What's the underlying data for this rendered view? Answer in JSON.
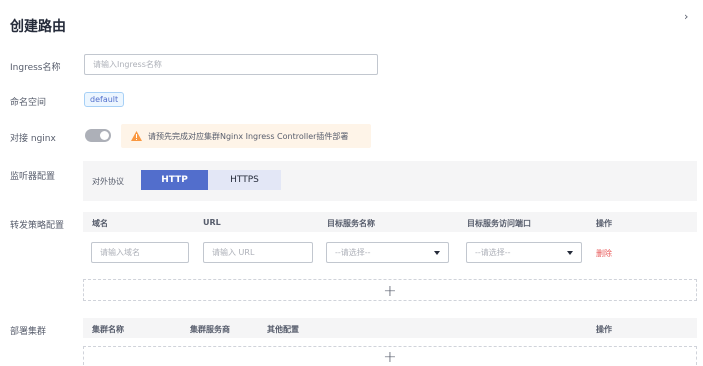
{
  "page": {
    "title": "创建路由"
  },
  "ingress_name": {
    "label": "Ingress名称",
    "placeholder": "请输入Ingress名称"
  },
  "namespace": {
    "label": "命名空间",
    "value": "default"
  },
  "nginx": {
    "label": "对接 nginx",
    "toggle_on": false,
    "warning": "请预先完成对应集群Nginx Ingress Controller插件部署"
  },
  "listener": {
    "label": "监听器配置",
    "protocol_label": "对外协议",
    "options": [
      "HTTP",
      "HTTPS"
    ],
    "selected": "HTTP"
  },
  "forwarding": {
    "label": "转发策略配置",
    "columns": [
      "域名",
      "URL",
      "目标服务名称",
      "目标服务访问端口",
      "操作"
    ],
    "row": {
      "domain_placeholder": "请输入域名",
      "url_placeholder": "请输入 URL",
      "service_select": "--请选择--",
      "port_select": "--请选择--",
      "delete_label": "删除"
    },
    "add_symbol": "+"
  },
  "deploy_cluster": {
    "label": "部署集群",
    "columns": [
      "集群名称",
      "集群服务商",
      "其他配置",
      "操作"
    ],
    "add_symbol": "+"
  },
  "colors": {
    "primary": "#526ecc",
    "danger": "#e85a5a",
    "warning_bg": "#fef4e8",
    "warning_icon": "#fa9841"
  }
}
